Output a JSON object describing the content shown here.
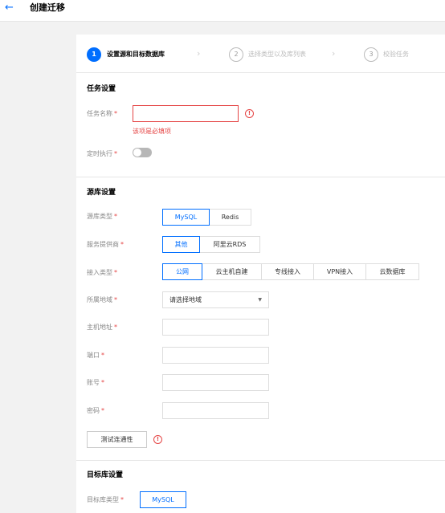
{
  "header": {
    "back_icon": "arrow-left-icon",
    "title": "创建迁移"
  },
  "steps": [
    {
      "num": "1",
      "label": "设置源和目标数据库",
      "active": true
    },
    {
      "num": "2",
      "label": "选择类型以及库列表",
      "active": false
    },
    {
      "num": "3",
      "label": "校验任务",
      "active": false
    }
  ],
  "task": {
    "section_title": "任务设置",
    "name_label": "任务名称",
    "name_value": "",
    "name_error": "该项是必填项",
    "schedule_label": "定时执行",
    "schedule_on": false
  },
  "source": {
    "section_title": "源库设置",
    "db_type_label": "源库类型",
    "db_types": [
      "MySQL",
      "Redis"
    ],
    "provider_label": "服务提供商",
    "providers": [
      "其他",
      "阿里云RDS"
    ],
    "access_label": "接入类型",
    "access_types": [
      "公网",
      "云主机自建",
      "专线接入",
      "VPN接入",
      "云数据库"
    ],
    "region_label": "所属地域",
    "region_value": "请选择地域",
    "host_label": "主机地址",
    "port_label": "端口",
    "account_label": "账号",
    "password_label": "密码",
    "test_button": "测试连通性"
  },
  "target": {
    "section_title": "目标库设置",
    "db_type_label": "目标库类型",
    "db_type_value": "MySQL"
  },
  "required_mark": "*",
  "error_mark": "!",
  "colors": {
    "accent": "#006eff",
    "error": "#e54545"
  }
}
